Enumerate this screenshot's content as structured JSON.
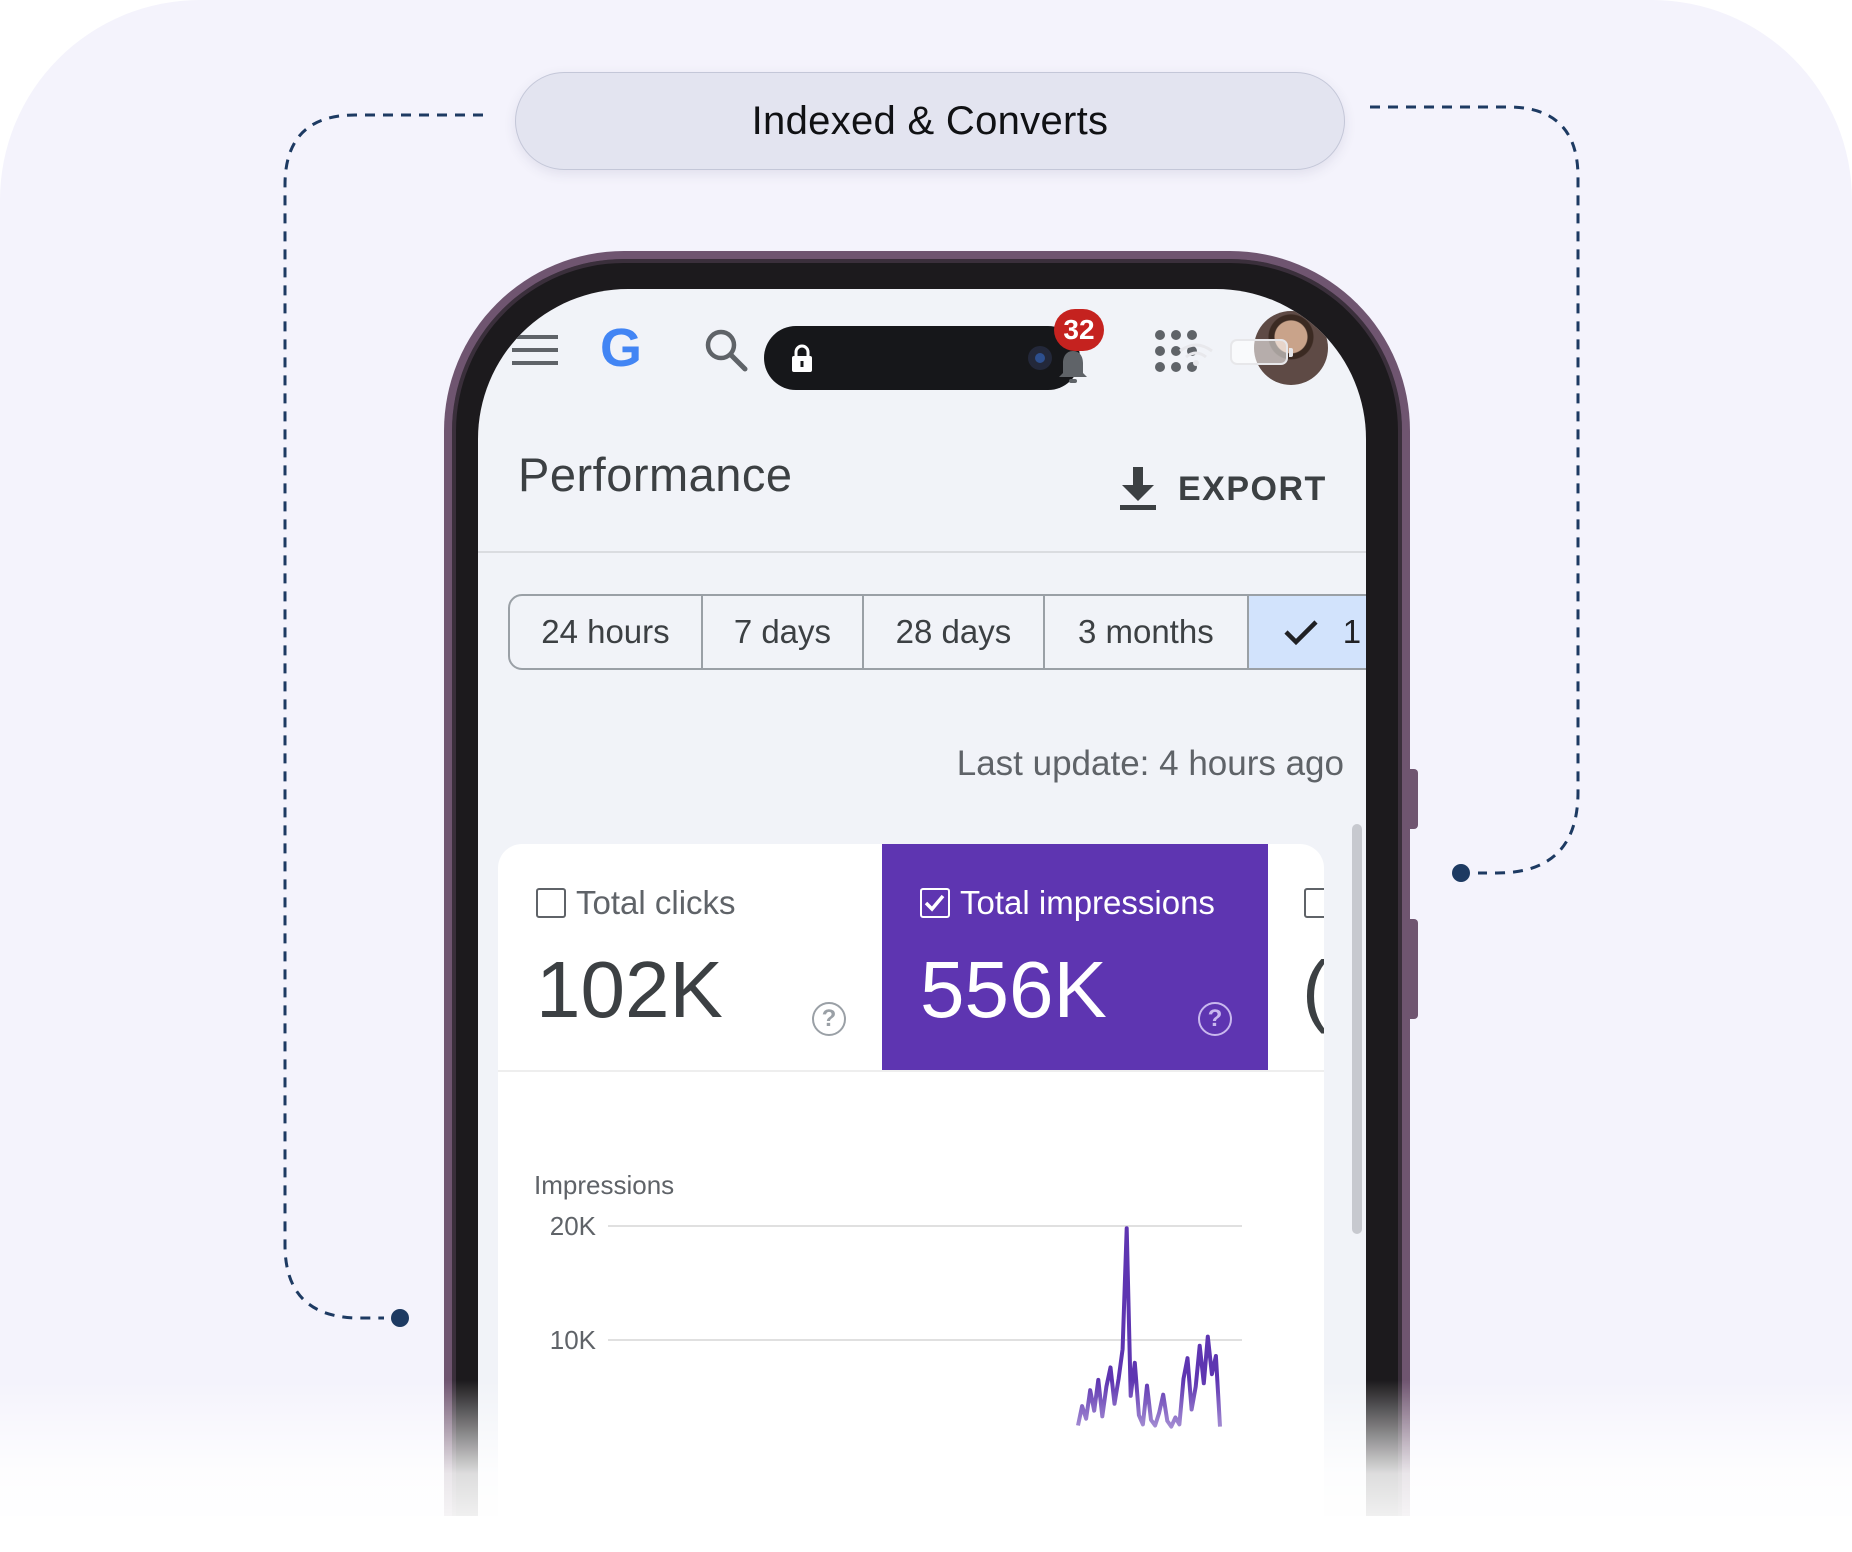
{
  "badge": {
    "label": "Indexed & Converts"
  },
  "top_bar": {
    "logo_letter": "G",
    "notification_count": "32",
    "icons": [
      "menu-icon",
      "google-logo",
      "search-icon",
      "notifications-icon",
      "apps-grid-icon",
      "avatar"
    ]
  },
  "header": {
    "title": "Performance",
    "export_label": "EXPORT"
  },
  "date_range": {
    "chips": [
      "24 hours",
      "7 days",
      "28 days",
      "3 months"
    ],
    "selected_chip_partial": "1",
    "selected_color": "#d2e3fc"
  },
  "last_update": "Last update: 4 hours ago",
  "metrics": {
    "total_clicks": {
      "label": "Total clicks",
      "value": "102K",
      "checked": false
    },
    "total_impressions": {
      "label": "Total impressions",
      "value": "556K",
      "checked": true,
      "color": "#5e35b1"
    },
    "third_metric_partial": "("
  },
  "chart_data": {
    "type": "line",
    "title": "",
    "ylabel": "Impressions",
    "xlabel": "",
    "y_ticks": [
      "20K",
      "10K"
    ],
    "ylim": [
      0,
      20000
    ],
    "grid": true,
    "series": [
      {
        "color": "#5e35b1",
        "x": [
          0,
          1,
          2,
          3,
          4,
          5,
          6,
          7,
          8,
          9,
          10,
          11,
          12,
          13,
          14,
          15,
          16,
          17,
          18,
          19,
          20,
          21,
          22,
          23,
          24,
          25,
          26,
          27,
          28,
          29,
          30,
          31,
          32,
          33,
          34,
          35
        ],
        "values": [
          2500,
          4200,
          3100,
          5600,
          3800,
          6500,
          3300,
          5900,
          7600,
          4400,
          6600,
          9200,
          19800,
          5100,
          8000,
          3400,
          2600,
          6000,
          3000,
          2500,
          3600,
          5200,
          2900,
          2400,
          3200,
          2600,
          6600,
          8400,
          3900,
          5900,
          9500,
          6200,
          10300,
          7000,
          8600,
          2400
        ]
      }
    ]
  }
}
